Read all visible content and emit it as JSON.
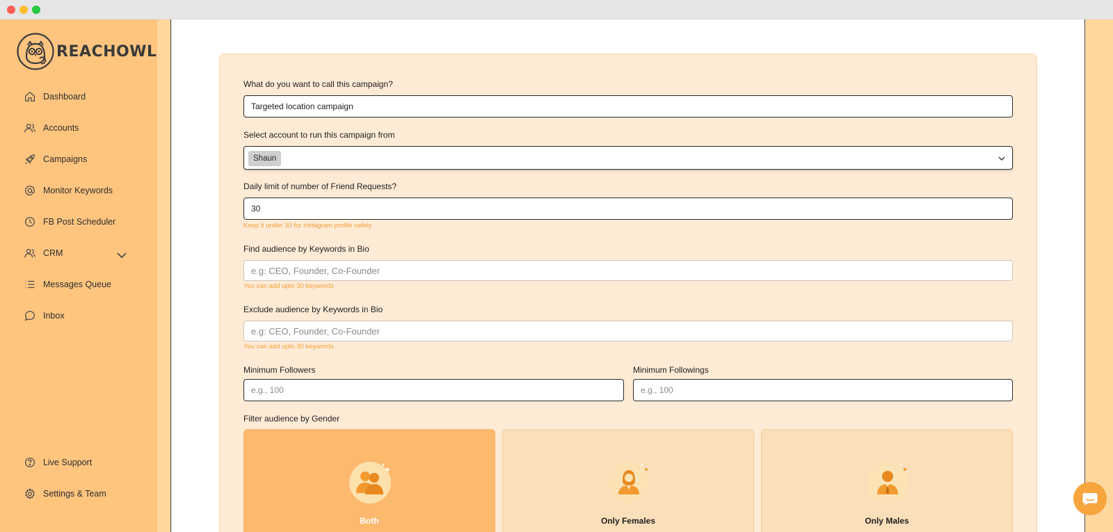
{
  "app": {
    "brand": "REACHOWL",
    "colors": {
      "sidebar": "#ffc57f",
      "accent": "#f7a53d",
      "card": "#fdebd6",
      "selected_card": "#fdb96e",
      "hint": "#f2a03a"
    }
  },
  "sidebar": {
    "items": [
      {
        "label": "Dashboard",
        "icon": "home-icon"
      },
      {
        "label": "Accounts",
        "icon": "users-icon"
      },
      {
        "label": "Campaigns",
        "icon": "rocket-icon"
      },
      {
        "label": "Monitor Keywords",
        "icon": "at-sign-icon"
      },
      {
        "label": "FB Post Scheduler",
        "icon": "clock-icon"
      },
      {
        "label": "CRM",
        "icon": "users-icon",
        "expandable": true
      },
      {
        "label": "Messages Queue",
        "icon": "list-icon"
      },
      {
        "label": "Inbox",
        "icon": "chat-bubble-icon"
      }
    ],
    "footer": [
      {
        "label": "Live Support",
        "icon": "help-circle-icon"
      },
      {
        "label": "Settings & Team",
        "icon": "gear-icon"
      }
    ]
  },
  "form": {
    "campaign_name": {
      "label": "What do you want to call this campaign?",
      "value": "Targeted location campaign"
    },
    "account": {
      "label": "Select account to run this campaign from",
      "selected": "Shaun"
    },
    "daily_limit": {
      "label": "Daily limit of number of Friend Requests?",
      "value": "30",
      "hint": "Keep it under 30 for instagram profile safety"
    },
    "include_keywords": {
      "label": "Find audience by Keywords in Bio",
      "placeholder": "e.g: CEO, Founder, Co-Founder",
      "hint": "You can add upto 30 keywords"
    },
    "exclude_keywords": {
      "label": "Exclude audience by Keywords in Bio",
      "placeholder": "e.g: CEO, Founder, Co-Founder",
      "hint": "You can add upto 30 keywords"
    },
    "min_followers": {
      "label": "Minimum Followers",
      "placeholder": "e.g., 100"
    },
    "min_followings": {
      "label": "Minimum Followings",
      "placeholder": "e.g., 100"
    },
    "gender": {
      "label": "Filter audience by Gender",
      "options": [
        {
          "label": "Both",
          "icon": "couple-icon",
          "selected": true
        },
        {
          "label": "Only Females",
          "icon": "female-icon",
          "selected": false
        },
        {
          "label": "Only Males",
          "icon": "male-icon",
          "selected": false
        }
      ]
    }
  }
}
